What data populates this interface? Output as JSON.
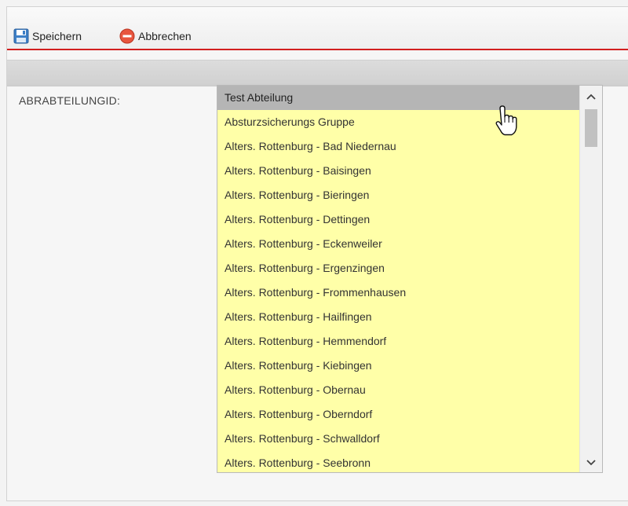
{
  "toolbar": {
    "save_label": "Speichern",
    "cancel_label": "Abbrechen"
  },
  "form": {
    "field_label": "ABRABTEILUNGID:"
  },
  "listbox": {
    "selected_value": "Test Abteilung",
    "options": [
      "Test Abteilung",
      "Absturzsicherungs Gruppe",
      "Alters. Rottenburg - Bad Niedernau",
      "Alters. Rottenburg - Baisingen",
      "Alters. Rottenburg - Bieringen",
      "Alters. Rottenburg - Dettingen",
      "Alters. Rottenburg - Eckenweiler",
      "Alters. Rottenburg - Ergenzingen",
      "Alters. Rottenburg - Frommenhausen",
      "Alters. Rottenburg - Hailfingen",
      "Alters. Rottenburg - Hemmendorf",
      "Alters. Rottenburg - Kiebingen",
      "Alters. Rottenburg - Obernau",
      "Alters. Rottenburg - Oberndorf",
      "Alters. Rottenburg - Schwalldorf",
      "Alters. Rottenburg - Seebronn"
    ]
  },
  "colors": {
    "accent_line": "#d21f1f",
    "list_background": "#ffffa8",
    "selected_row": "#b5b5b5"
  }
}
